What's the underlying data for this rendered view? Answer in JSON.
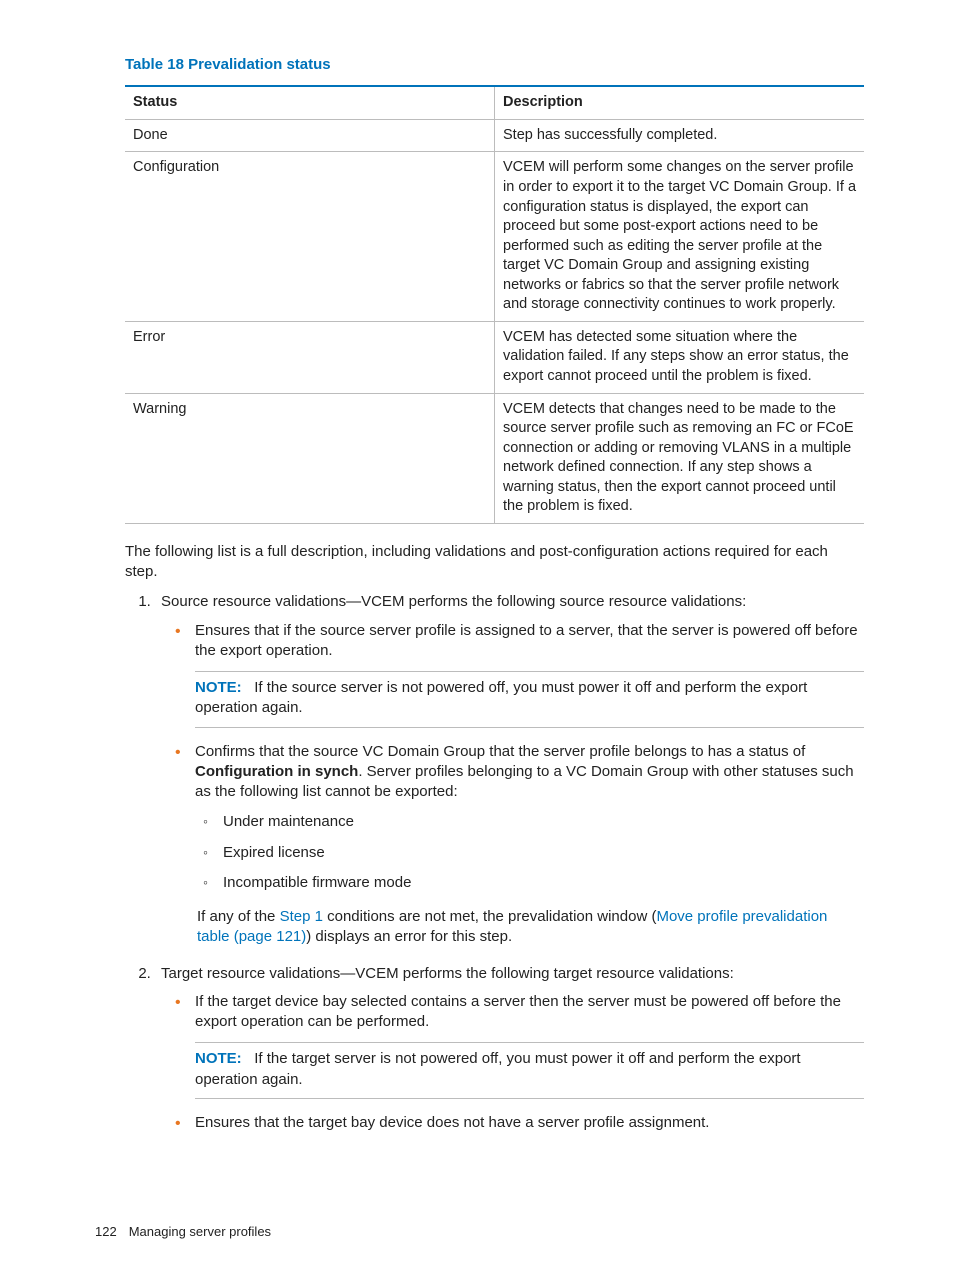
{
  "tableTitle": "Table 18 Prevalidation status",
  "table": {
    "headers": [
      "Status",
      "Description"
    ],
    "rows": [
      {
        "status": "Done",
        "desc": "Step has successfully completed."
      },
      {
        "status": "Configuration",
        "desc": "VCEM will perform some changes on the server profile in order to export it to the target VC Domain Group. If a configuration status is displayed, the export can proceed but some post-export actions need to be performed such as editing the server profile at the target VC Domain Group and assigning existing networks or fabrics so that the server profile network and storage connectivity continues to work properly."
      },
      {
        "status": "Error",
        "desc": "VCEM has detected some situation where the validation failed. If any steps show an error status, the export cannot proceed until the problem is fixed."
      },
      {
        "status": "Warning",
        "desc": "VCEM detects that changes need to be made to the source server profile such as removing an FC or FCoE connection or adding or removing VLANS in a multiple network defined connection. If any step shows a warning status, then the export cannot proceed until the problem is fixed."
      }
    ]
  },
  "intro": "The following list is a full description, including validations and post-configuration actions required for each step.",
  "step1": {
    "lead": "Source resource validations—VCEM performs the following source resource validations:",
    "bullet1": "Ensures that if the source server profile is assigned to a server, that the server is powered off before the export operation.",
    "note1_label": "NOTE:",
    "note1_text": "If the source server is not powered off, you must power it off and perform the export operation again.",
    "bullet2_pre": "Confirms that the source VC Domain Group that the server profile belongs to has a status of ",
    "bullet2_bold": "Configuration in synch",
    "bullet2_post": ". Server profiles belonging to a VC Domain Group with other statuses such as the following list cannot be exported:",
    "sub": [
      "Under maintenance",
      "Expired license",
      "Incompatible firmware mode"
    ],
    "closing_pre": "If any of the ",
    "closing_link1": "Step 1",
    "closing_mid": " conditions are not met, the prevalidation window (",
    "closing_link2": "Move profile prevalidation table (page 121)",
    "closing_post": ") displays an error for this step."
  },
  "step2": {
    "lead": "Target resource validations—VCEM performs the following target resource validations:",
    "bullet1": "If the target device bay selected contains a server then the server must be powered off before the export operation can be performed.",
    "note_label": "NOTE:",
    "note_text": "If the target server is not powered off, you must power it off and perform the export operation again.",
    "bullet2": "Ensures that the target bay device does not have a server profile assignment."
  },
  "footer": {
    "page": "122",
    "section": "Managing server profiles"
  }
}
